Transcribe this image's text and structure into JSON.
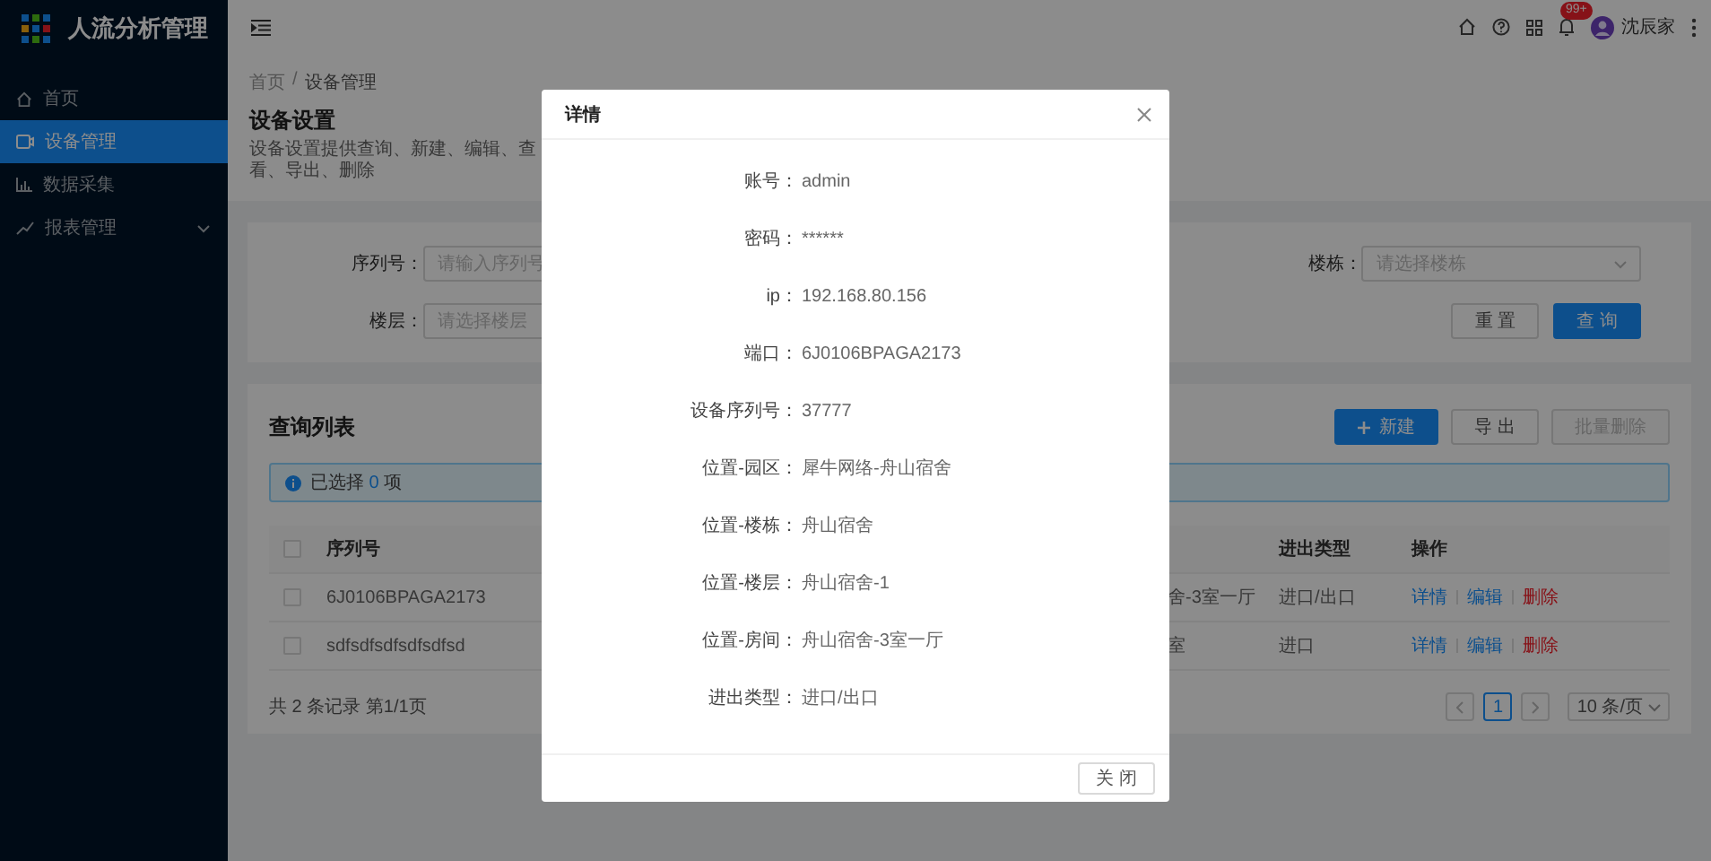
{
  "app": {
    "title": "人流分析管理"
  },
  "sidebar": {
    "items": [
      {
        "label": "首页",
        "selected": false
      },
      {
        "label": "设备管理",
        "selected": true
      },
      {
        "label": "数据采集",
        "selected": false
      },
      {
        "label": "报表管理",
        "selected": false,
        "expanded": false
      }
    ]
  },
  "header": {
    "badge": "99+",
    "user": "沈辰家"
  },
  "breadcrumb": {
    "items": [
      "首页",
      "设备管理"
    ],
    "separator": "/"
  },
  "page": {
    "title": "设备设置",
    "description": "设备设置提供查询、新建、编辑、查看、导出、删除"
  },
  "filters": [
    {
      "label": "序列号：",
      "placeholder": "请输入序列号",
      "kind": "input"
    },
    {
      "label": "楼栋：",
      "placeholder": "请选择楼栋",
      "kind": "select"
    },
    {
      "label": "楼层：",
      "placeholder": "请选择楼层",
      "kind": "input"
    }
  ],
  "filter_buttons": [
    {
      "label": "重 置",
      "kind": "default"
    },
    {
      "label": "查 询",
      "kind": "primary"
    }
  ],
  "list": {
    "title": "查询列表",
    "actions": [
      {
        "label": "新建",
        "kind": "primary",
        "disabled": false
      },
      {
        "label": "导 出",
        "kind": "default",
        "disabled": false
      },
      {
        "label": "批量删除",
        "kind": "default",
        "disabled": true
      }
    ],
    "alert": {
      "prefix": "已选择",
      "count": "0",
      "suffix": "项"
    },
    "columns": [
      {
        "label": "序列号"
      },
      {
        "label": "进出类型"
      },
      {
        "label": "操作"
      }
    ],
    "header_checked": false,
    "rows": [
      {
        "serial": "6J0106BPAGA2173",
        "location": "舍-3室一厅",
        "direction": "进口/出口",
        "checked": false,
        "actions": [
          {
            "label": "详情",
            "kind": "link"
          },
          {
            "label": "编辑",
            "kind": "link"
          },
          {
            "label": "删除",
            "kind": "danger"
          }
        ]
      },
      {
        "serial": "sdfsdfsdfsdfsdfsd",
        "location": "室",
        "direction": "进口",
        "checked": false,
        "actions": [
          {
            "label": "详情",
            "kind": "link"
          },
          {
            "label": "编辑",
            "kind": "link"
          },
          {
            "label": "删除",
            "kind": "danger"
          }
        ]
      }
    ],
    "summary": "共 2 条记录 第1/1页",
    "pages": [
      {
        "label": "1",
        "selected": true
      }
    ],
    "page_size": "10 条/页"
  },
  "modal": {
    "title": "详情",
    "fields": [
      {
        "label": "账号：",
        "value": "admin"
      },
      {
        "label": "密码：",
        "value": "******"
      },
      {
        "label": "ip：",
        "value": "192.168.80.156"
      },
      {
        "label": "端口：",
        "value": "6J0106BPAGA2173"
      },
      {
        "label": "设备序列号：",
        "value": "37777"
      },
      {
        "label": "位置-园区：",
        "value": "犀牛网络-舟山宿舍"
      },
      {
        "label": "位置-楼栋：",
        "value": "舟山宿舍"
      },
      {
        "label": "位置-楼层：",
        "value": "舟山宿舍-1"
      },
      {
        "label": "位置-房间：",
        "value": "舟山宿舍-3室一厅"
      },
      {
        "label": "进出类型：",
        "value": "进口/出口"
      }
    ],
    "close_button": "关 闭"
  }
}
